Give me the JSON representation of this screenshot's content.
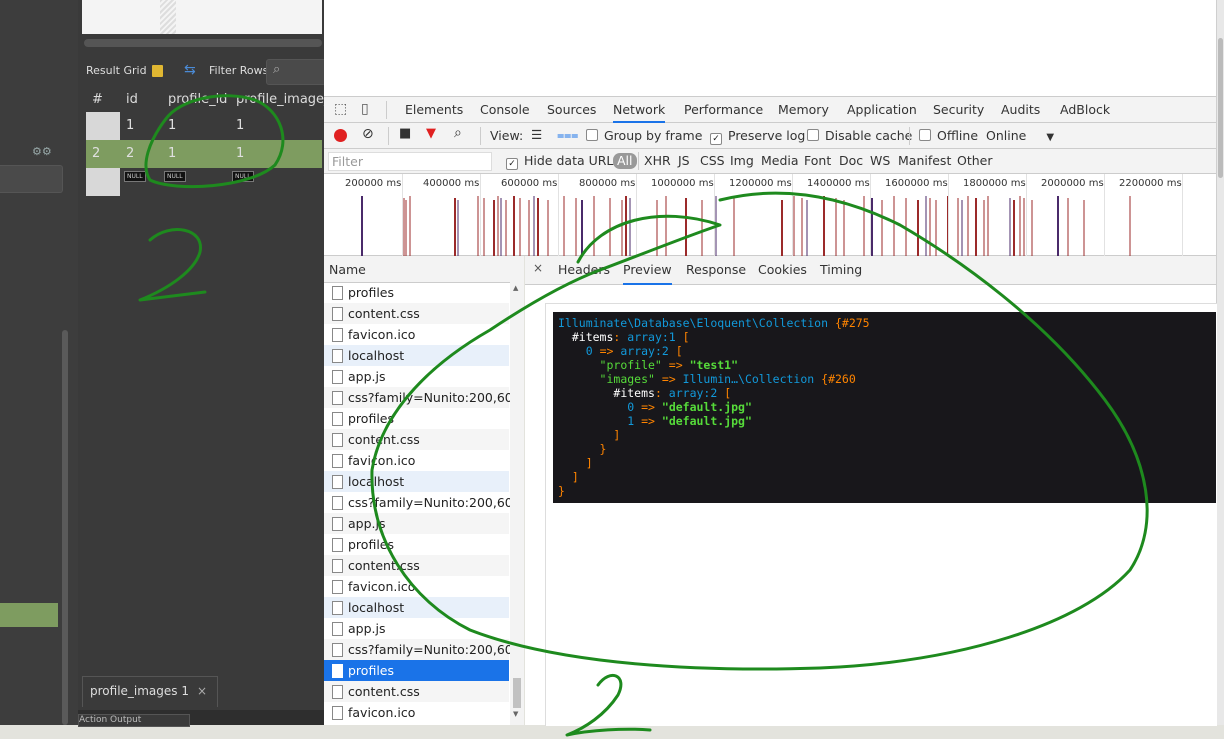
{
  "workbench": {
    "result_grid_label": "Result Grid",
    "filter_rows_label": "Filter Rows:",
    "columns": [
      "#",
      "id",
      "profile_id",
      "profile_image_"
    ],
    "rows": [
      {
        "num": "",
        "id": "1",
        "profile_id": "1",
        "profile_image": "1",
        "selected": false
      },
      {
        "num": "2",
        "id": "2",
        "profile_id": "1",
        "profile_image": "1",
        "selected": true
      },
      {
        "num": "",
        "id": "NULL",
        "profile_id": "NULL",
        "profile_image": "NULL",
        "selected": false
      }
    ],
    "bottom_tab": "profile_images 1",
    "bottom_tab_close": "×",
    "bottom_mini": "Action Output"
  },
  "devtools": {
    "tabs": [
      "Elements",
      "Console",
      "Sources",
      "Network",
      "Performance",
      "Memory",
      "Application",
      "Security",
      "Audits",
      "AdBlock"
    ],
    "active_tab": "Network",
    "toolbar": {
      "view_label": "View:",
      "group_by_frame": "Group by frame",
      "preserve_log": "Preserve log",
      "disable_cache": "Disable cache",
      "offline": "Offline",
      "throttle": "Online"
    },
    "filter": {
      "placeholder": "Filter",
      "hide_data_urls": "Hide data URLs",
      "all": "All",
      "types": [
        "XHR",
        "JS",
        "CSS",
        "Img",
        "Media",
        "Font",
        "Doc",
        "WS",
        "Manifest",
        "Other"
      ]
    },
    "timeline_ticks": [
      "200000 ms",
      "400000 ms",
      "600000 ms",
      "800000 ms",
      "1000000 ms",
      "1200000 ms",
      "1400000 ms",
      "1600000 ms",
      "1800000 ms",
      "2000000 ms",
      "2200000 ms",
      "2"
    ],
    "name_header": "Name",
    "requests": [
      "profiles",
      "content.css",
      "favicon.ico",
      "localhost",
      "app.js",
      "css?family=Nunito:200,600",
      "profiles",
      "content.css",
      "favicon.ico",
      "localhost",
      "css?family=Nunito:200,600",
      "app.js",
      "profiles",
      "content.css",
      "favicon.ico",
      "localhost",
      "app.js",
      "css?family=Nunito:200,600",
      "profiles",
      "content.css",
      "favicon.ico"
    ],
    "detail_close": "×",
    "detail_tabs": [
      "Headers",
      "Preview",
      "Response",
      "Cookies",
      "Timing"
    ],
    "active_detail_tab": "Preview"
  },
  "dump": {
    "collection_class": "Illuminate\\Database\\Eloquent\\Collection",
    "collection_id": "#275",
    "items_label": "#items",
    "array1": "array:1",
    "array2": "array:2",
    "profile_key": "\"profile\"",
    "profile_value": "\"test1\"",
    "images_key": "\"images\"",
    "images_class": "Illumin…\\Collection",
    "images_id": "#260",
    "img0": "\"default.jpg\"",
    "img1": "\"default.jpg\""
  },
  "annotations": {
    "digit": "2"
  },
  "colors": {
    "accent": "#1a73e8",
    "record": "#e02020",
    "selected_row": "#7e9c60",
    "dump_bg": "#18171b",
    "annotation": "#1e8a1e"
  }
}
